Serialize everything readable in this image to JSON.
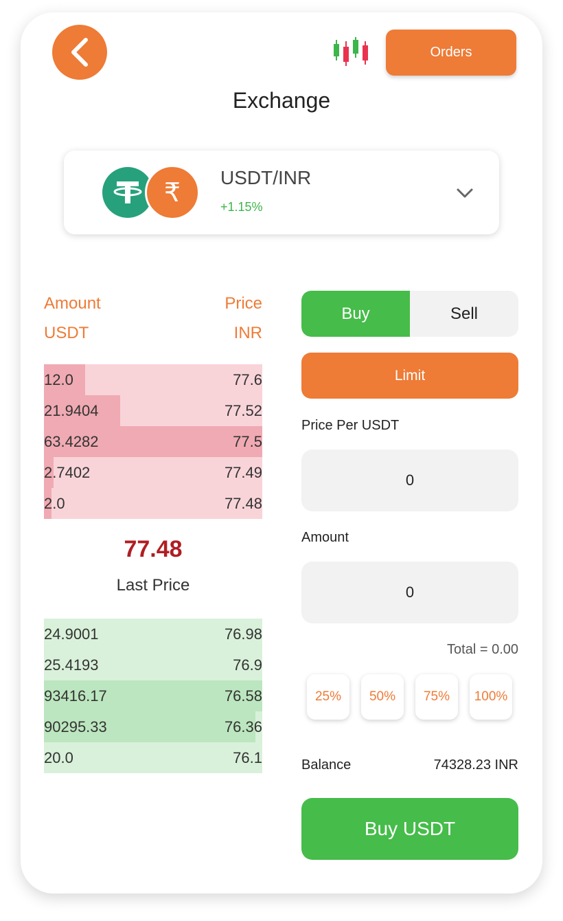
{
  "header": {
    "title": "Exchange",
    "orders_label": "Orders",
    "back_icon": "chevron-left-icon",
    "chart_icon": "candlestick-chart-icon"
  },
  "pair": {
    "name": "USDT/INR",
    "change": "+1.15%",
    "rupee_symbol": "₹"
  },
  "orderbook": {
    "amount_label": "Amount",
    "amount_unit": "USDT",
    "price_label": "Price",
    "price_unit": "INR",
    "sells": [
      {
        "amount": "12.0",
        "price": "77.6",
        "depth": 0.19
      },
      {
        "amount": "21.9404",
        "price": "77.52",
        "depth": 0.35
      },
      {
        "amount": "63.4282",
        "price": "77.5",
        "depth": 1.0
      },
      {
        "amount": "2.7402",
        "price": "77.49",
        "depth": 0.045
      },
      {
        "amount": "2.0",
        "price": "77.48",
        "depth": 0.035
      }
    ],
    "last_price": "77.48",
    "last_price_label": "Last Price",
    "buys": [
      {
        "amount": "24.9001",
        "price": "76.98",
        "depth": 0.0
      },
      {
        "amount": "25.4193",
        "price": "76.9",
        "depth": 0.0
      },
      {
        "amount": "93416.17",
        "price": "76.58",
        "depth": 1.0
      },
      {
        "amount": "90295.33",
        "price": "76.36",
        "depth": 0.967
      },
      {
        "amount": "20.0",
        "price": "76.1",
        "depth": 0.0
      }
    ]
  },
  "trade": {
    "buy_label": "Buy",
    "sell_label": "Sell",
    "order_type": "Limit",
    "price_label": "Price Per USDT",
    "price_value": "0",
    "amount_label": "Amount",
    "amount_value": "0",
    "total": "Total = 0.00",
    "percent_options": [
      "25%",
      "50%",
      "75%",
      "100%"
    ],
    "balance_label": "Balance",
    "balance_value": "74328.23 INR",
    "submit_label": "Buy USDT"
  },
  "colors": {
    "accent": "#EE7B36",
    "buy": "#46BC4A",
    "sell_fill": "#F0AAB3",
    "last_price": "#B01E23"
  }
}
